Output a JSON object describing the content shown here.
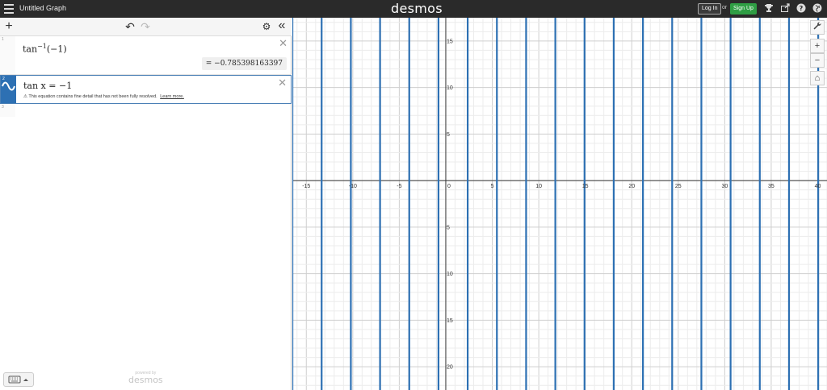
{
  "header": {
    "title": "Untitled Graph",
    "brand": "desmos",
    "login_label": "Log In",
    "or_text": "or",
    "signup_label": "Sign Up",
    "icons": [
      "trophy-icon",
      "share-icon",
      "help-icon",
      "globe-icon"
    ]
  },
  "toolbar": {
    "add_icon": "+",
    "undo_icon": "↶",
    "redo_icon": "↷",
    "settings_icon": "⚙",
    "collapse_icon": "«"
  },
  "expressions": [
    {
      "number": "1",
      "base": "tan",
      "sup": "−1",
      "arg": "(−1)",
      "result": "= −0.785398163397"
    },
    {
      "number": "2",
      "latex": "tan x = −1",
      "warning_text": "This equation contains fine detail that has not been fully resolved.",
      "learn_more": "Learn more."
    },
    {
      "number": "3"
    }
  ],
  "footer": {
    "powered_small": "powered by",
    "powered_brand": "desmos"
  },
  "graph_controls": {
    "wrench_icon": "wrench-icon",
    "zoom_in": "+",
    "zoom_out": "−",
    "home_icon": "⌂"
  },
  "colors": {
    "curve": "#2d70b3",
    "header_bg": "#2a2a2a",
    "signup_bg": "#2f9e44"
  },
  "graph": {
    "x_ticks": [
      "-15",
      "-10",
      "-5",
      "0",
      "5",
      "10",
      "15",
      "20",
      "25",
      "30",
      "35",
      "40"
    ],
    "y_ticks_pos": [
      "15",
      "10",
      "5"
    ],
    "y_ticks_neg": [
      "5",
      "10",
      "15",
      "20"
    ],
    "x_range": [
      -16.5,
      41
    ],
    "y_range": [
      -22.5,
      17.5
    ],
    "curve_period": 3.14159265,
    "curve_offset": -0.785398163397
  }
}
